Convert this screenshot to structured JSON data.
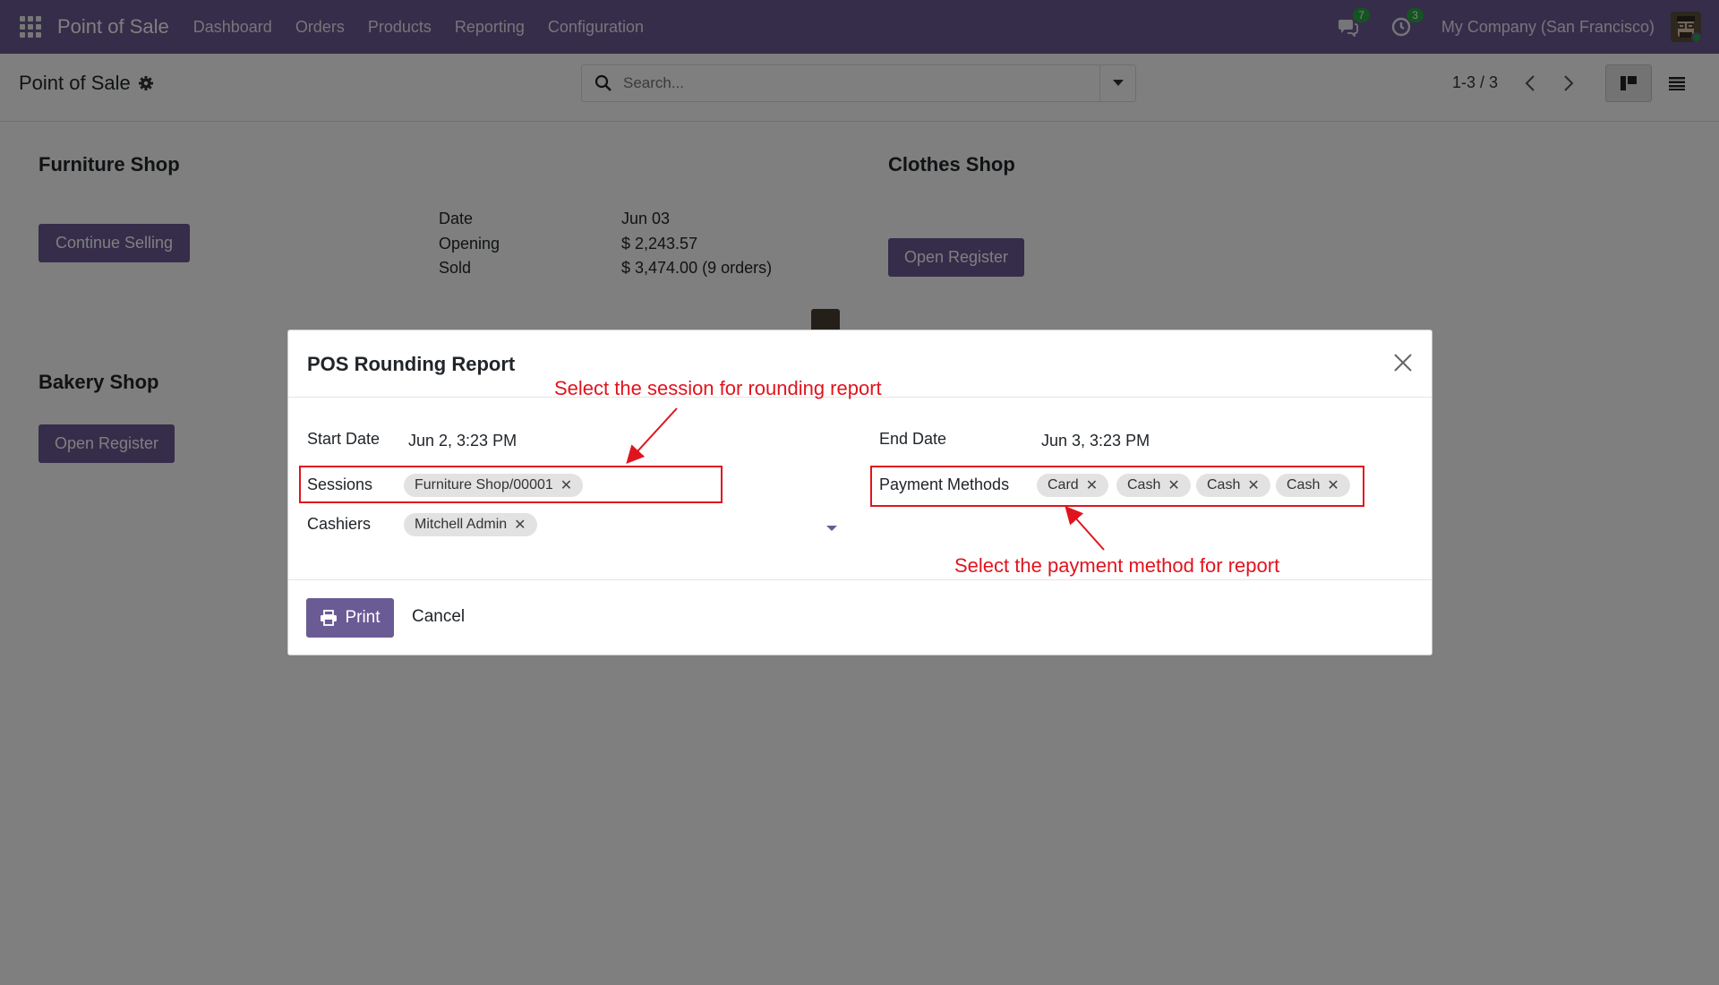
{
  "navbar": {
    "brand": "Point of Sale",
    "menu": [
      "Dashboard",
      "Orders",
      "Products",
      "Reporting",
      "Configuration"
    ],
    "messages_count": "7",
    "activities_count": "3",
    "company": "My Company (San Francisco)"
  },
  "control_panel": {
    "title": "Point of Sale",
    "search_placeholder": "Search...",
    "pager": "1-3 / 3"
  },
  "shops": {
    "furniture": {
      "name": "Furniture Shop",
      "button": "Continue Selling",
      "date_label": "Date",
      "date_value": "Jun 03",
      "opening_label": "Opening",
      "opening_value": "$ 2,243.57",
      "sold_label": "Sold",
      "sold_value": "$ 3,474.00 (9 orders)"
    },
    "clothes": {
      "name": "Clothes Shop",
      "button": "Open Register"
    },
    "bakery": {
      "name": "Bakery Shop",
      "button": "Open Register"
    }
  },
  "dialog": {
    "title": "POS Rounding Report",
    "start_date_label": "Start Date",
    "start_date_value": "Jun 2, 3:23 PM",
    "end_date_label": "End Date",
    "end_date_value": "Jun 3, 3:23 PM",
    "sessions_label": "Sessions",
    "sessions": [
      "Furniture Shop/00001"
    ],
    "cashiers_label": "Cashiers",
    "cashiers": [
      "Mitchell Admin"
    ],
    "payment_methods_label": "Payment Methods",
    "payment_methods": [
      "Card",
      "Cash",
      "Cash",
      "Cash"
    ],
    "print_label": "Print",
    "cancel_label": "Cancel"
  },
  "annotations": {
    "session_note": "Select the session for rounding report",
    "payment_note": "Select the payment method for report",
    "color": "#e0141e"
  },
  "colors": {
    "brand": "#6b5b95",
    "badge": "#28a745"
  }
}
